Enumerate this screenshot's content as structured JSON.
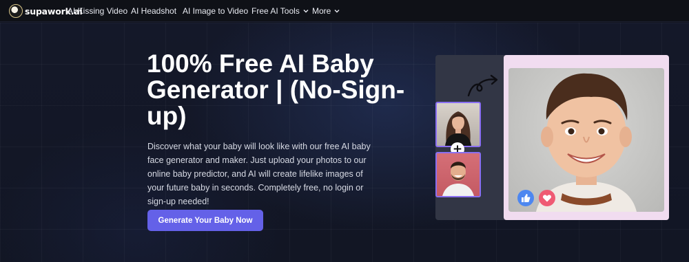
{
  "brand": {
    "logo_text": "supawork.ai"
  },
  "nav": {
    "items": [
      {
        "label": "AI Kissing Video"
      },
      {
        "label": "AI Headshot"
      },
      {
        "label": "AI Image to Video"
      },
      {
        "label": "Free AI Tools",
        "has_dropdown": true
      },
      {
        "label": "More",
        "has_dropdown": true
      }
    ]
  },
  "hero": {
    "title": "100% Free AI Baby Generator | (No-Sign-up)",
    "description": "Discover what your baby will look like with our free AI baby face generator and maker. Just upload your photos to our online baby predictor, and AI will create lifelike images of your future baby in seconds. Completely free, no login or sign-up needed!",
    "cta_label": "Generate Your Baby Now"
  },
  "illustration": {
    "plus_symbol": "+",
    "icons": [
      "curved-arrow-icon",
      "thumbs-up-icon",
      "heart-icon"
    ]
  },
  "colors": {
    "background": "#111420",
    "cta": "#6461e8",
    "thumb_border": "#8a6ff2",
    "result_frame": "#f1dcf0",
    "like": "#4d87f0",
    "heart": "#ef5b73"
  }
}
